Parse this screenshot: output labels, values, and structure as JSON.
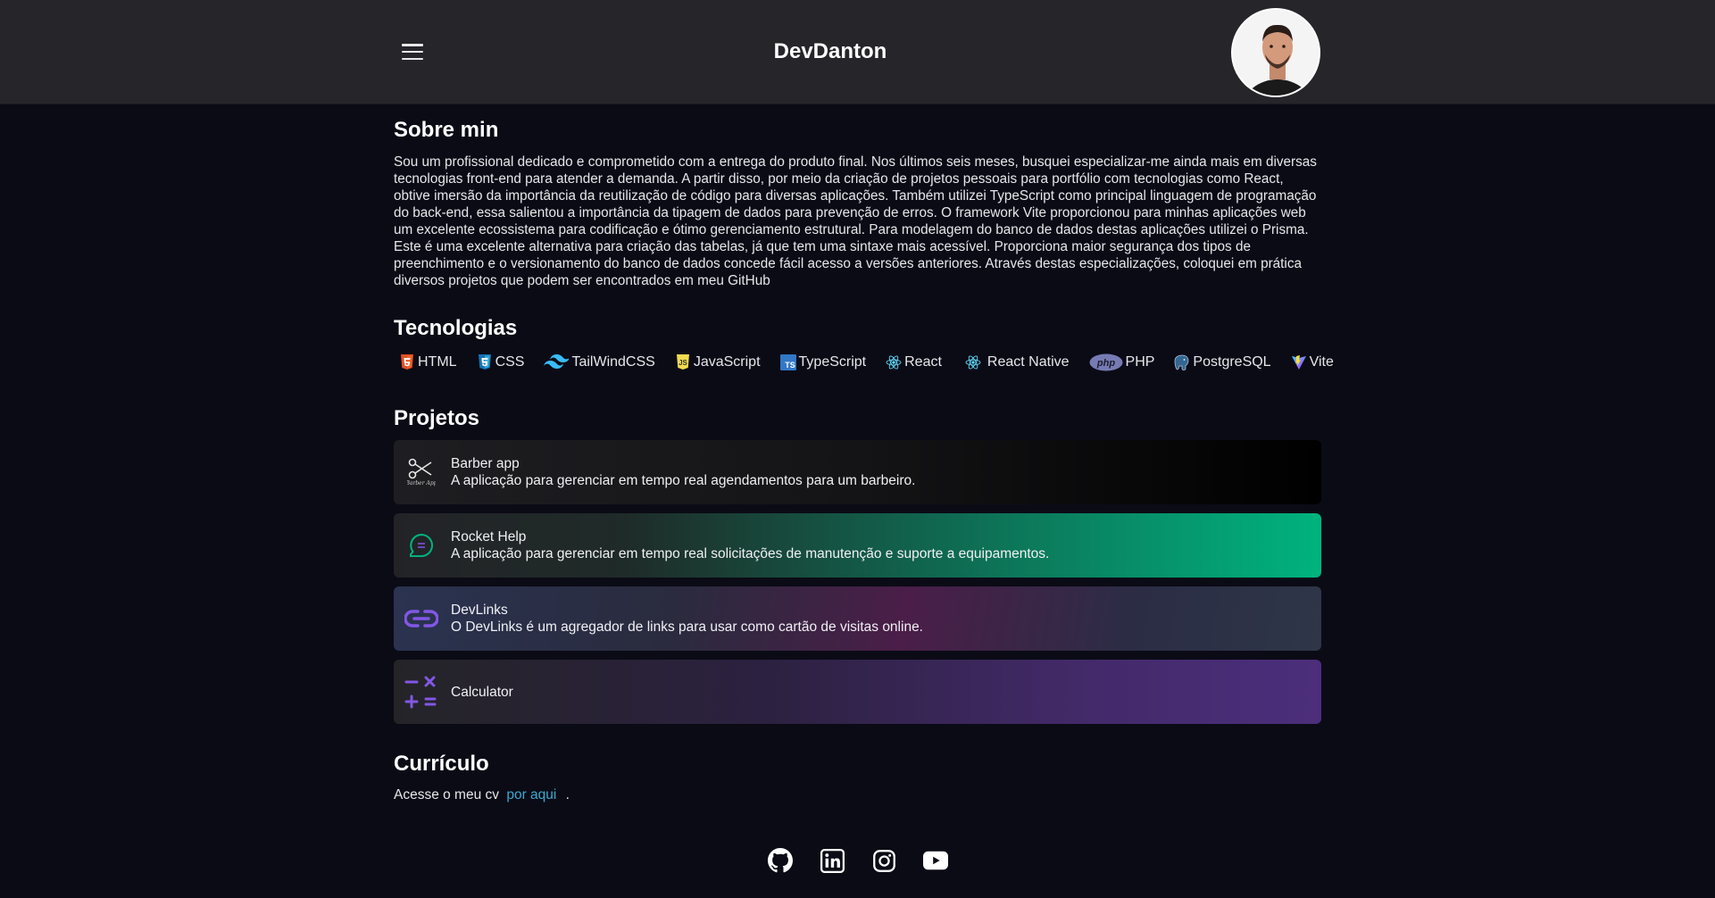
{
  "header": {
    "brand": "DevDanton",
    "menu_icon": "hamburger-icon",
    "avatar": "profile-avatar"
  },
  "about": {
    "title": "Sobre min",
    "text": "Sou um profissional dedicado e comprometido com a entrega do produto final. Nos últimos seis meses, busquei especializar-me ainda mais em diversas tecnologias front-end para atender a demanda. A partir disso, por meio da criação de projetos pessoais para portfólio com tecnologias como React, obtive imersão da importância da reutilização de código para diversas aplicações. Também utilizei TypeScript como principal linguagem de programação do back-end, essa salientou a importância da tipagem de dados para prevenção de erros. O framework Vite proporcionou para minhas aplicações web um excelente ecossistema para codificação e ótimo gerenciamento estrutural. Para modelagem do banco de dados destas aplicações utilizei o Prisma. Este é uma excelente alternativa para criação das tabelas, já que tem uma sintaxe mais acessível. Proporciona maior segurança dos tipos de preenchimento e o versionamento do banco de dados concede fácil acesso a versões anteriores. Através destas especializações, coloquei em prática diversos projetos que podem ser encontrados em meu GitHub"
  },
  "tech": {
    "title": "Tecnologias",
    "items": [
      {
        "label": "HTML",
        "icon": "html5-icon",
        "color": "#e34f26"
      },
      {
        "label": "CSS",
        "icon": "css3-icon",
        "color": "#1572b6"
      },
      {
        "label": "TailWindCSS",
        "icon": "tailwind-icon",
        "color": "#38bdf8"
      },
      {
        "label": "JavaScript",
        "icon": "javascript-icon",
        "color": "#f0db4f"
      },
      {
        "label": "TypeScript",
        "icon": "typescript-icon",
        "color": "#3178c6"
      },
      {
        "label": "React",
        "icon": "react-icon",
        "color": "#61dafb"
      },
      {
        "label": "React Native",
        "icon": "react-native-icon",
        "color": "#61dafb"
      },
      {
        "label": "PHP",
        "icon": "php-icon",
        "color": "#777bb4"
      },
      {
        "label": "PostgreSQL",
        "icon": "postgresql-icon",
        "color": "#336791"
      },
      {
        "label": "Vite",
        "icon": "vite-icon",
        "color": "#646cff"
      }
    ]
  },
  "projects": {
    "title": "Projetos",
    "items": [
      {
        "name": "Barber app",
        "desc": "A aplicação para gerenciar em tempo real agendamentos para um barbeiro.",
        "icon": "scissors-icon"
      },
      {
        "name": "Rocket Help",
        "desc": "A aplicação para gerenciar em tempo real solicitações de manutenção e suporte a equipamentos.",
        "icon": "chat-bubble-icon"
      },
      {
        "name": "DevLinks",
        "desc": "O DevLinks é um agregador de links para usar como cartão de visitas online.",
        "icon": "link-icon"
      },
      {
        "name": "Calculator",
        "desc": "",
        "icon": "calculator-icon"
      }
    ]
  },
  "cv": {
    "title": "Currículo",
    "prefix": "Acesse o meu cv",
    "link": "por aqui",
    "suffix": "."
  },
  "socials": [
    "github-icon",
    "linkedin-icon",
    "instagram-icon",
    "youtube-icon"
  ],
  "colors": {
    "background": "#0b0b16",
    "header": "#25252a",
    "link": "#3fa7ce",
    "accent_green": "#00b37e",
    "accent_purple": "#8257e5"
  }
}
